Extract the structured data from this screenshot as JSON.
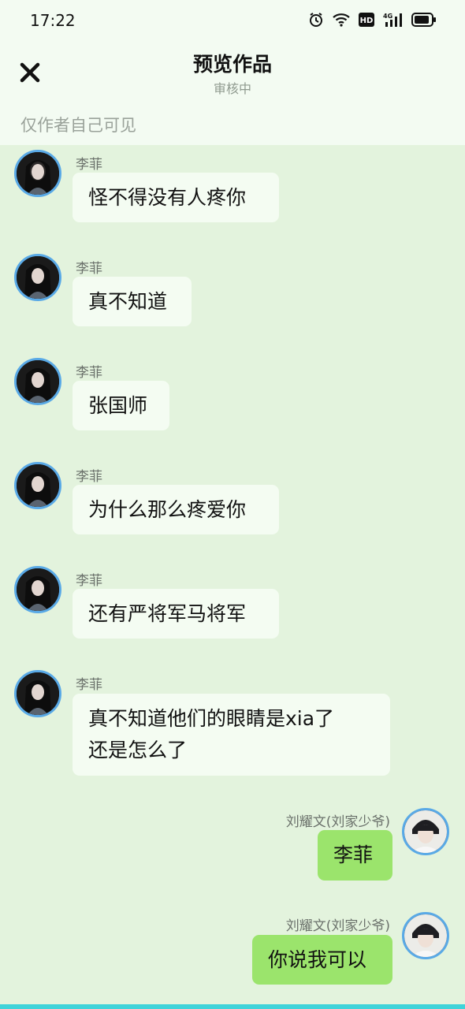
{
  "status_bar": {
    "time": "17:22",
    "icons": [
      "alarm-icon",
      "wifi-icon",
      "hd-icon",
      "signal-4g-icon",
      "battery-icon"
    ],
    "hd_label": "HD",
    "network_label": "4G"
  },
  "header": {
    "title": "预览作品",
    "subtitle": "审核中",
    "visibility_note": "仅作者自己可见",
    "close_icon": "close-icon"
  },
  "messages": [
    {
      "sender": "李菲",
      "side": "left",
      "text": "怪不得没有人疼你"
    },
    {
      "sender": "李菲",
      "side": "left",
      "text": "真不知道"
    },
    {
      "sender": "李菲",
      "side": "left",
      "text": "张国师"
    },
    {
      "sender": "李菲",
      "side": "left",
      "text": "为什么那么疼爱你"
    },
    {
      "sender": "李菲",
      "side": "left",
      "text": "还有严将军马将军"
    },
    {
      "sender": "李菲",
      "side": "left",
      "lines": [
        "真不知道他们的眼睛是xia了",
        "还是怎么了"
      ]
    },
    {
      "sender": "刘耀文(刘家少爷)",
      "side": "right",
      "text": "李菲"
    },
    {
      "sender": "刘耀文(刘家少爷)",
      "side": "right",
      "text": "你说我可以"
    }
  ],
  "colors": {
    "chat_background": "#e3f3dd",
    "header_background": "#f3fbf2",
    "left_bubble": "#f4fcf2",
    "right_bubble": "#9be46c",
    "avatar_ring": "#59a9e6",
    "bottom_accent": "#3fd3d9"
  }
}
